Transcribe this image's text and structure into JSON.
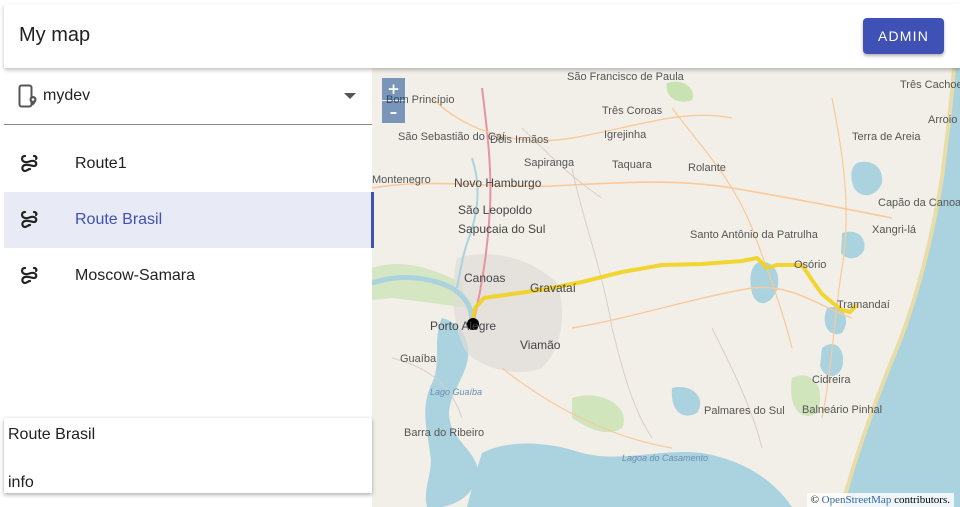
{
  "app": {
    "title": "My map",
    "admin_label": "ADMIN"
  },
  "device": {
    "name": "mydev",
    "icon": "phone-location-icon"
  },
  "routes": [
    {
      "label": "Route1",
      "icon": "route-icon",
      "selected": false
    },
    {
      "label": "Route Brasil",
      "icon": "route-icon",
      "selected": true
    },
    {
      "label": "Moscow-Samara",
      "icon": "route-icon",
      "selected": false
    }
  ],
  "info": {
    "route_name": "Route Brasil",
    "label": "info"
  },
  "map": {
    "zoom_in": "+",
    "zoom_out": "–",
    "attribution_prefix": "© ",
    "attribution_link": "OpenStreetMap",
    "attribution_suffix": " contributors.",
    "route_color": "#f1d21c",
    "marker_color": "#000000",
    "places": [
      "Bom Princípio",
      "São Francisco de Paula",
      "Três Cachoeiras",
      "Três Coroas",
      "Arroio do Sal",
      "São Sebastião do Caí",
      "Dois Irmãos",
      "Igrejinha",
      "Terra de Areia",
      "Sapiranga",
      "Taquara",
      "Montenegro",
      "Novo Hamburgo",
      "Rolante",
      "Capão da Canoa",
      "São Leopoldo",
      "Xangri-lá",
      "Sapucaia do Sul",
      "Santo Antônio da Patrulha",
      "Osório",
      "Canoas",
      "Gravataí",
      "Tramandaí",
      "Porto Alegre",
      "Viamão",
      "Guaíba",
      "Lago Guaíba",
      "Cidreira",
      "Palmares do Sul",
      "Balneário Pinhal",
      "Barra do Ribeiro",
      "Lagoa do Casamento"
    ]
  }
}
